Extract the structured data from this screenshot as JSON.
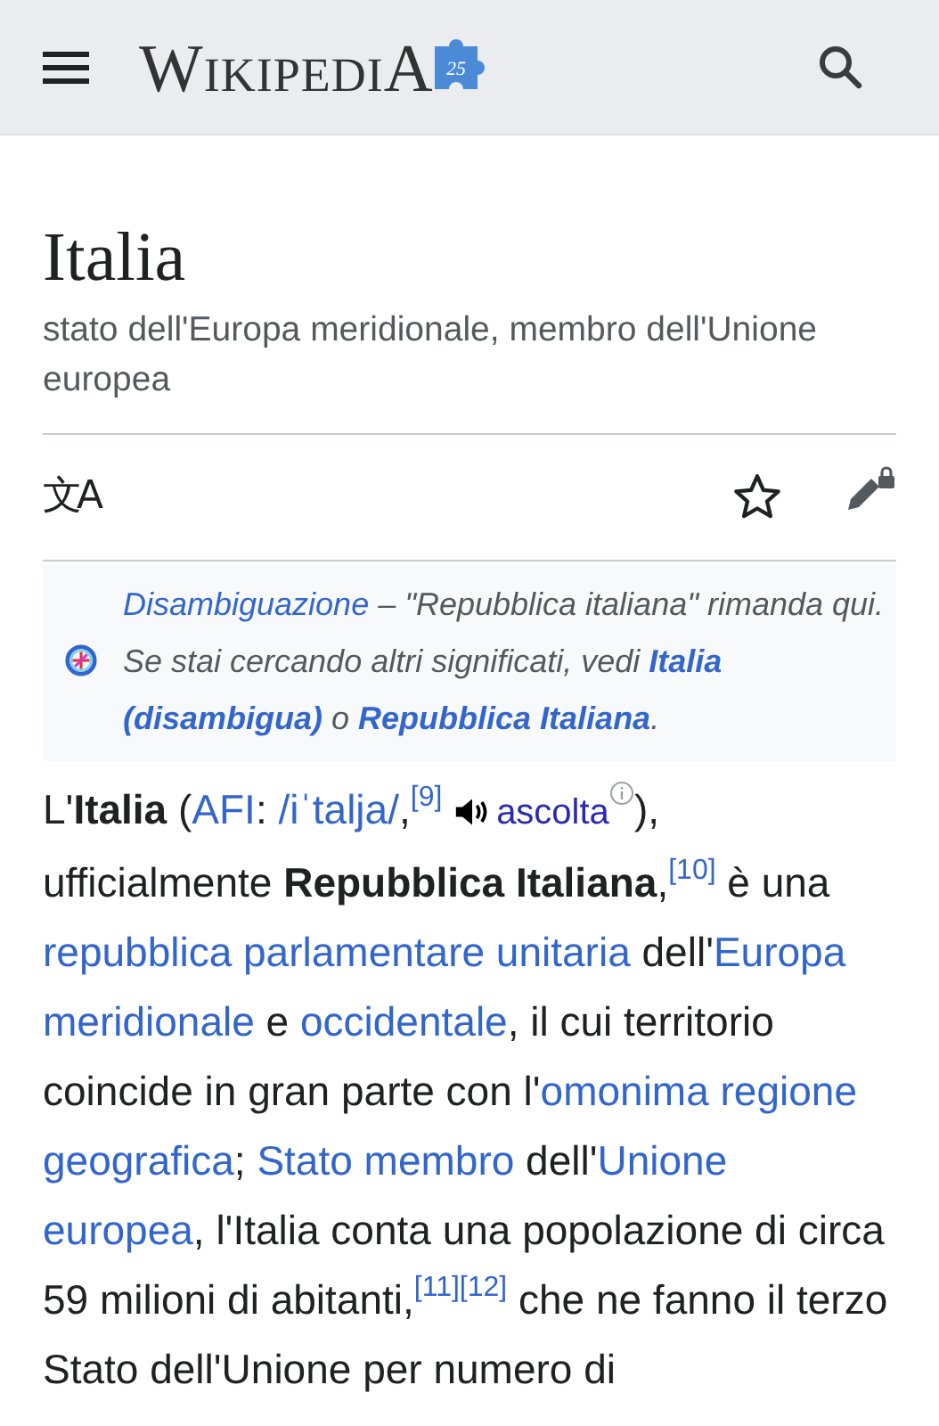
{
  "header": {
    "logo": "WikipediA",
    "logo_badge": "25"
  },
  "page": {
    "title": "Italia",
    "description": "stato dell'Europa meridionale, membro dell'Unione europea"
  },
  "toolbar": {
    "language_glyph": "文A",
    "watched": false
  },
  "hatnote": [
    {
      "kind": "link",
      "text": "Disambiguazione"
    },
    {
      "kind": "text",
      "text": " – \"Repubblica italiana\" rimanda qui. Se stai cercando altri significati, vedi "
    },
    {
      "kind": "boldlink",
      "text": "Italia"
    },
    {
      "kind": "gap"
    },
    {
      "kind": "boldlink",
      "text": "(disambigua)"
    },
    {
      "kind": "text",
      "text": " o "
    },
    {
      "kind": "boldlink",
      "text": "Repubblica Italiana"
    },
    {
      "kind": "text",
      "text": "."
    }
  ],
  "paragraph": [
    {
      "kind": "text",
      "text": "L'"
    },
    {
      "kind": "bold",
      "text": "Italia"
    },
    {
      "kind": "text",
      "text": " ("
    },
    {
      "kind": "link",
      "text": "AFI"
    },
    {
      "kind": "text",
      "text": ": "
    },
    {
      "kind": "link",
      "text": "/iˈtalja/"
    },
    {
      "kind": "text",
      "text": ","
    },
    {
      "kind": "ref",
      "text": "[9]"
    },
    {
      "kind": "gap"
    },
    {
      "kind": "audio",
      "text": "ascolta"
    },
    {
      "kind": "info"
    },
    {
      "kind": "text",
      "text": "), ufficialmente "
    },
    {
      "kind": "bold",
      "text": "Repubblica Italiana"
    },
    {
      "kind": "text",
      "text": ","
    },
    {
      "kind": "ref",
      "text": "[10]"
    },
    {
      "kind": "text",
      "text": " è una "
    },
    {
      "kind": "link",
      "text": "repubblica parlamentare unitaria"
    },
    {
      "kind": "text",
      "text": " dell'"
    },
    {
      "kind": "link",
      "text": "Europa"
    },
    {
      "kind": "gap"
    },
    {
      "kind": "link",
      "text": "meridionale"
    },
    {
      "kind": "text",
      "text": " e "
    },
    {
      "kind": "link",
      "text": "occidentale"
    },
    {
      "kind": "text",
      "text": ", il cui territorio coincide in gran parte con l'"
    },
    {
      "kind": "link",
      "text": "omonima regione"
    },
    {
      "kind": "gap"
    },
    {
      "kind": "link",
      "text": "geografica"
    },
    {
      "kind": "text",
      "text": "; "
    },
    {
      "kind": "link",
      "text": "Stato membro"
    },
    {
      "kind": "text",
      "text": " dell'"
    },
    {
      "kind": "link",
      "text": "Unione"
    },
    {
      "kind": "gap"
    },
    {
      "kind": "link",
      "text": "europea"
    },
    {
      "kind": "text",
      "text": ", l'Italia conta una popolazione di circa 59 milioni di abitanti,"
    },
    {
      "kind": "ref",
      "text": "[11]"
    },
    {
      "kind": "ref",
      "text": "[12]"
    },
    {
      "kind": "text",
      "text": " che ne fanno il terzo Stato dell'Unione per numero di"
    }
  ]
}
